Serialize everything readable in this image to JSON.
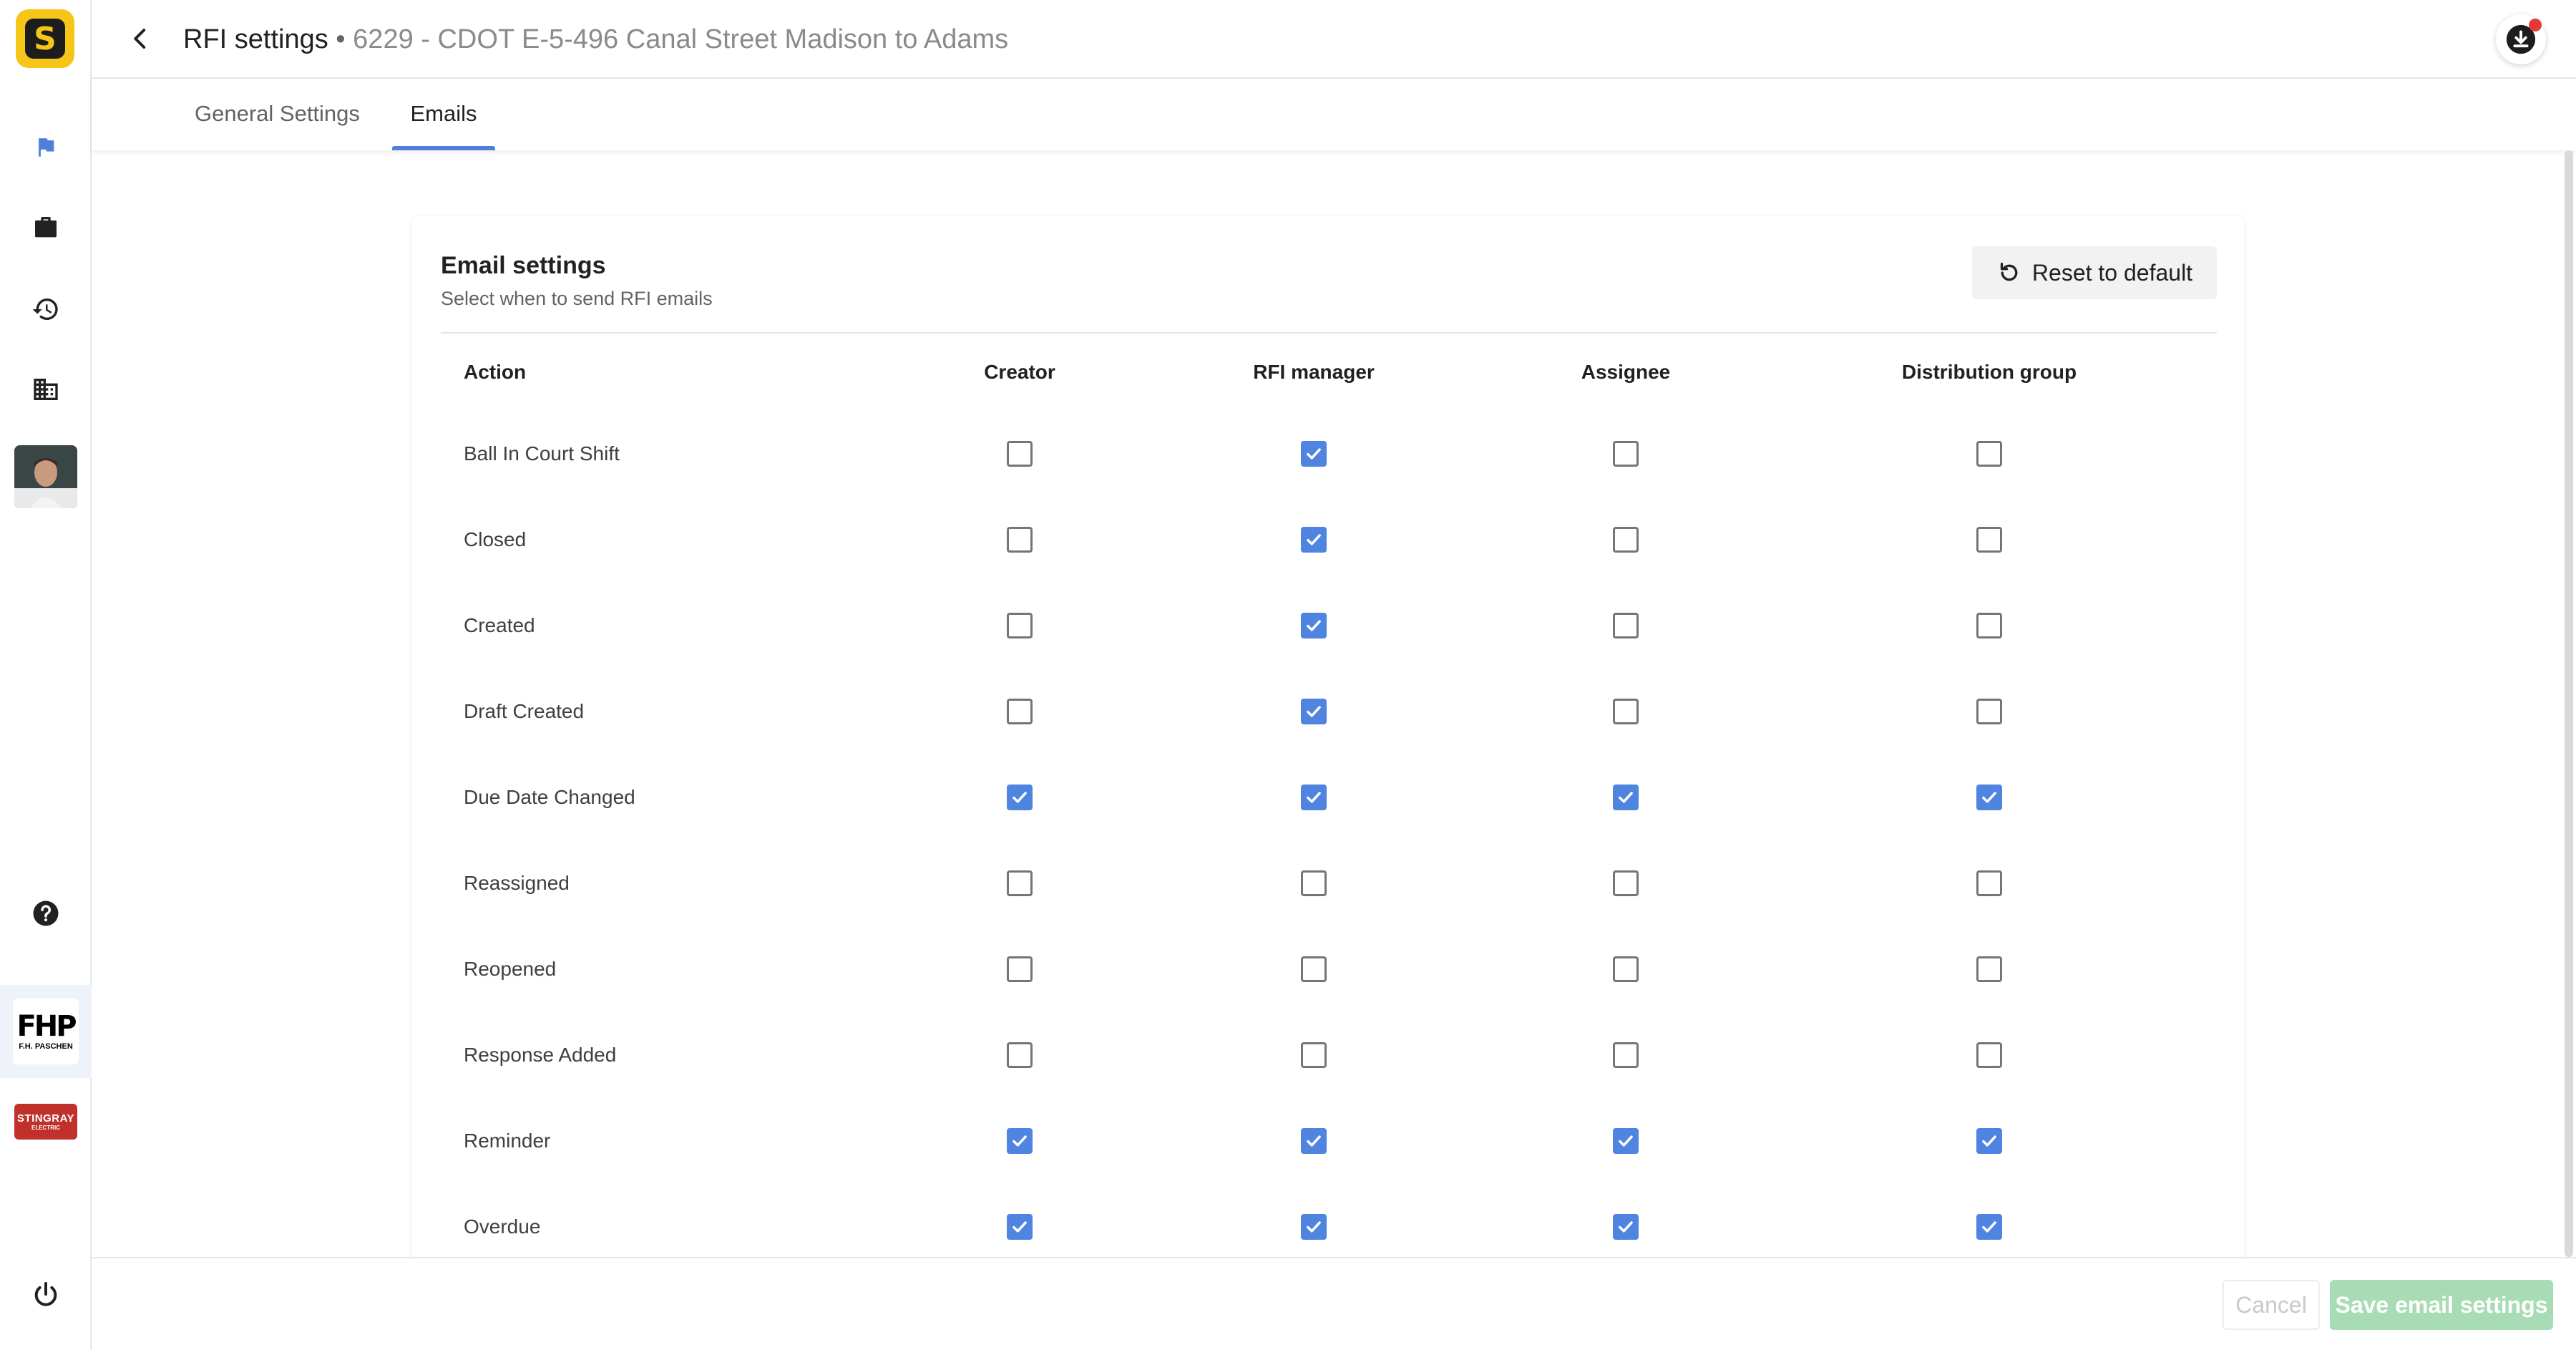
{
  "header": {
    "title": "RFI settings",
    "separator": "•",
    "project": "6229 - CDOT E-5-496 Canal Street Madison to Adams"
  },
  "sidebar": {
    "logo_letter": "S",
    "items": [
      {
        "name": "flag-icon"
      },
      {
        "name": "briefcase-icon"
      },
      {
        "name": "history-icon"
      },
      {
        "name": "building-icon"
      }
    ],
    "companies": [
      {
        "name": "F.H. PASCHEN",
        "mark": "FHP"
      },
      {
        "name": "STINGRAY",
        "sub": "ELECTRIC"
      }
    ]
  },
  "tabs": [
    {
      "label": "General Settings",
      "active": false
    },
    {
      "label": "Emails",
      "active": true
    }
  ],
  "card": {
    "title": "Email settings",
    "subtitle": "Select when to send RFI emails",
    "reset_label": "Reset to default"
  },
  "table": {
    "columns": [
      "Action",
      "Creator",
      "RFI manager",
      "Assignee",
      "Distribution group"
    ],
    "rows": [
      {
        "action": "Ball In Court Shift",
        "checks": [
          false,
          true,
          false,
          false
        ]
      },
      {
        "action": "Closed",
        "checks": [
          false,
          true,
          false,
          false
        ]
      },
      {
        "action": "Created",
        "checks": [
          false,
          true,
          false,
          false
        ]
      },
      {
        "action": "Draft Created",
        "checks": [
          false,
          true,
          false,
          false
        ]
      },
      {
        "action": "Due Date Changed",
        "checks": [
          true,
          true,
          true,
          true
        ]
      },
      {
        "action": "Reassigned",
        "checks": [
          false,
          false,
          false,
          false
        ]
      },
      {
        "action": "Reopened",
        "checks": [
          false,
          false,
          false,
          false
        ]
      },
      {
        "action": "Response Added",
        "checks": [
          false,
          false,
          false,
          false
        ]
      },
      {
        "action": "Reminder",
        "checks": [
          true,
          true,
          true,
          true
        ]
      },
      {
        "action": "Overdue",
        "checks": [
          true,
          true,
          true,
          true
        ]
      }
    ]
  },
  "footer": {
    "cancel_label": "Cancel",
    "save_label": "Save email settings"
  },
  "colors": {
    "accent": "#4f84e0",
    "save_disabled": "#a8dcb4",
    "logo_yellow": "#f5c518"
  }
}
